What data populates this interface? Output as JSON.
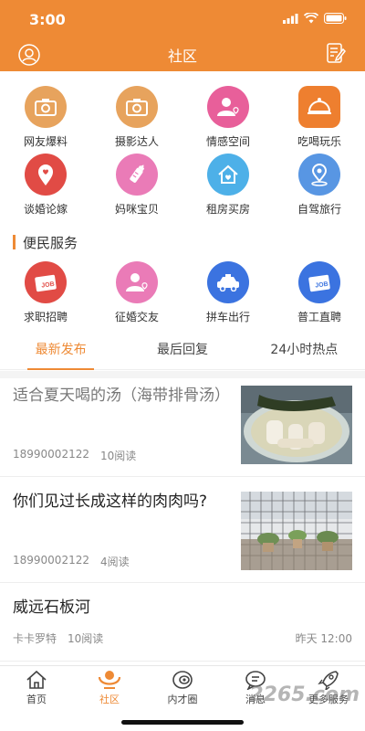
{
  "status": {
    "time": "3:00"
  },
  "header": {
    "title": "社区",
    "left_icon": "user-circle-icon",
    "right_icon": "edit-note-icon"
  },
  "categories": [
    {
      "label": "网友爆料",
      "icon": "camera-icon",
      "color": "#e7a35d"
    },
    {
      "label": "摄影达人",
      "icon": "camera-icon",
      "color": "#e7a35d"
    },
    {
      "label": "情感空间",
      "icon": "person-heart-icon",
      "color": "#e85f9a"
    },
    {
      "label": "吃喝玩乐",
      "icon": "food-cloche-icon",
      "color": "#ee7f2f"
    },
    {
      "label": "谈婚论嫁",
      "icon": "location-heart-icon",
      "color": "#e14b45"
    },
    {
      "label": "妈咪宝贝",
      "icon": "baby-bottle-icon",
      "color": "#ea7bb7"
    },
    {
      "label": "租房买房",
      "icon": "house-icon",
      "color": "#4db0e8"
    },
    {
      "label": "自驾旅行",
      "icon": "location-pin-icon",
      "color": "#5896e3"
    }
  ],
  "services": {
    "title": "便民服务",
    "items": [
      {
        "label": "求职招聘",
        "icon": "job-card-icon",
        "color": "#e14b45"
      },
      {
        "label": "征婚交友",
        "icon": "person-heart-icon",
        "color": "#ea7bb7"
      },
      {
        "label": "拼车出行",
        "icon": "taxi-icon",
        "color": "#3b73e0"
      },
      {
        "label": "普工直聘",
        "icon": "job-card-icon",
        "color": "#3b73e0"
      }
    ]
  },
  "tabs": [
    {
      "label": "最新发布",
      "active": true
    },
    {
      "label": "最后回复",
      "active": false
    },
    {
      "label": "24小时热点",
      "active": false
    }
  ],
  "posts": [
    {
      "title": "适合夏天喝的汤（海带排骨汤）",
      "author": "18990002122",
      "reads": "10阅读",
      "time": "",
      "image": "soup-photo",
      "read": true
    },
    {
      "title": "你们见过长成这样的肉肉吗?",
      "author": "18990002122",
      "reads": "4阅读",
      "time": "",
      "image": "succulent-photo",
      "read": false
    },
    {
      "title": "威远石板河",
      "author": "卡卡罗特",
      "reads": "10阅读",
      "time": "昨天 12:00",
      "image": "",
      "read": false
    }
  ],
  "tabbar": [
    {
      "label": "首页",
      "icon": "home-icon",
      "active": false
    },
    {
      "label": "社区",
      "icon": "community-icon",
      "active": true
    },
    {
      "label": "内才圈",
      "icon": "circle-eye-icon",
      "active": false
    },
    {
      "label": "消息",
      "icon": "message-icon",
      "active": false
    },
    {
      "label": "更多服务",
      "icon": "rocket-icon",
      "active": false
    }
  ],
  "watermark": "2265.com"
}
